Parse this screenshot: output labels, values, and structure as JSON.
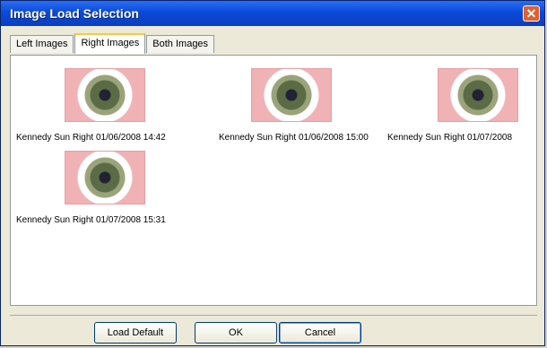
{
  "window": {
    "title": "Image Load Selection",
    "close_icon": "close-icon"
  },
  "tabs": [
    {
      "label": "Left Images"
    },
    {
      "label": "Right Images"
    },
    {
      "label": "Both Images"
    }
  ],
  "images": [
    {
      "label": "Kennedy Sun Right 01/06/2008 14:42"
    },
    {
      "label": "Kennedy Sun Right 01/06/2008 15:00"
    },
    {
      "label": "Kennedy Sun Right 01/07/2008"
    },
    {
      "label": "Kennedy Sun Right 01/07/2008 15:31"
    }
  ],
  "buttons": {
    "load_default": "Load Default",
    "ok": "OK",
    "cancel": "Cancel"
  }
}
